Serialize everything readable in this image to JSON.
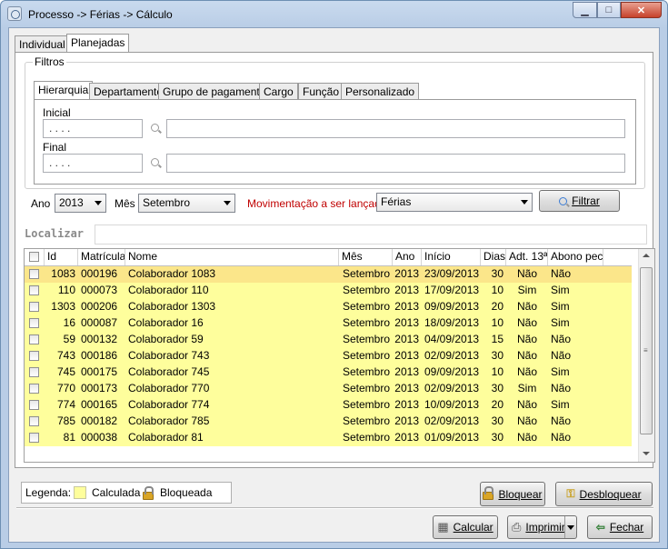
{
  "window": {
    "title": "Processo -> Férias -> Cálculo"
  },
  "tabs": [
    "Individual",
    "Planejadas"
  ],
  "filters": {
    "group_label": "Filtros",
    "tabs": [
      "Hierarquia",
      "Departamento",
      "Grupo de pagamento",
      "Cargo",
      "Função",
      "Personalizado"
    ],
    "inicial_label": "Inicial",
    "final_label": "Final",
    "inicial_code": " .  .  .  .",
    "final_code": " .  .  .  .",
    "inicial_desc": "",
    "final_desc": ""
  },
  "options": {
    "ano_label": "Ano",
    "ano_value": "2013",
    "mes_label": "Mês",
    "mes_value": "Setembro",
    "mov_label": "Movimentação a ser lançada:",
    "mov_value": "Férias",
    "mov_label_color": "#c00000",
    "filtrar_label": "Filtrar"
  },
  "localizar": {
    "label": "Localizar",
    "value": ""
  },
  "table": {
    "headers": [
      "",
      "Id",
      "Matrícula",
      "Nome",
      "Mês",
      "Ano",
      "Início",
      "Dias",
      "Adt. 13ª",
      "Abono pec."
    ],
    "rows": [
      {
        "id": "1083",
        "matricula": "000196",
        "nome": "Colaborador 1083",
        "mes": "Setembro",
        "ano": "2013",
        "inicio": "23/09/2013",
        "dias": "30",
        "adt": "Não",
        "abono": "Não"
      },
      {
        "id": "110",
        "matricula": "000073",
        "nome": "Colaborador 110",
        "mes": "Setembro",
        "ano": "2013",
        "inicio": "17/09/2013",
        "dias": "10",
        "adt": "Sim",
        "abono": "Sim"
      },
      {
        "id": "1303",
        "matricula": "000206",
        "nome": "Colaborador 1303",
        "mes": "Setembro",
        "ano": "2013",
        "inicio": "09/09/2013",
        "dias": "20",
        "adt": "Não",
        "abono": "Sim"
      },
      {
        "id": "16",
        "matricula": "000087",
        "nome": "Colaborador 16",
        "mes": "Setembro",
        "ano": "2013",
        "inicio": "18/09/2013",
        "dias": "10",
        "adt": "Não",
        "abono": "Sim"
      },
      {
        "id": "59",
        "matricula": "000132",
        "nome": "Colaborador 59",
        "mes": "Setembro",
        "ano": "2013",
        "inicio": "04/09/2013",
        "dias": "15",
        "adt": "Não",
        "abono": "Não"
      },
      {
        "id": "743",
        "matricula": "000186",
        "nome": "Colaborador 743",
        "mes": "Setembro",
        "ano": "2013",
        "inicio": "02/09/2013",
        "dias": "30",
        "adt": "Não",
        "abono": "Não"
      },
      {
        "id": "745",
        "matricula": "000175",
        "nome": "Colaborador 745",
        "mes": "Setembro",
        "ano": "2013",
        "inicio": "09/09/2013",
        "dias": "10",
        "adt": "Não",
        "abono": "Sim"
      },
      {
        "id": "770",
        "matricula": "000173",
        "nome": "Colaborador 770",
        "mes": "Setembro",
        "ano": "2013",
        "inicio": "02/09/2013",
        "dias": "30",
        "adt": "Sim",
        "abono": "Não"
      },
      {
        "id": "774",
        "matricula": "000165",
        "nome": "Colaborador 774",
        "mes": "Setembro",
        "ano": "2013",
        "inicio": "10/09/2013",
        "dias": "20",
        "adt": "Não",
        "abono": "Sim"
      },
      {
        "id": "785",
        "matricula": "000182",
        "nome": "Colaborador 785",
        "mes": "Setembro",
        "ano": "2013",
        "inicio": "02/09/2013",
        "dias": "30",
        "adt": "Não",
        "abono": "Não"
      },
      {
        "id": "81",
        "matricula": "000038",
        "nome": "Colaborador 81",
        "mes": "Setembro",
        "ano": "2013",
        "inicio": "01/09/2013",
        "dias": "30",
        "adt": "Não",
        "abono": "Não"
      }
    ],
    "row_color": "#fefe9c",
    "selected_row_color": "#fbe68a"
  },
  "legend": {
    "label": "Legenda:",
    "calculada": "Calculada",
    "bloqueada": "Bloqueada"
  },
  "buttons": {
    "bloquear": "Bloquear",
    "desbloquear": "Desbloquear",
    "calcular": "Calcular",
    "imprimir": "Imprimir",
    "fechar": "Fechar"
  }
}
